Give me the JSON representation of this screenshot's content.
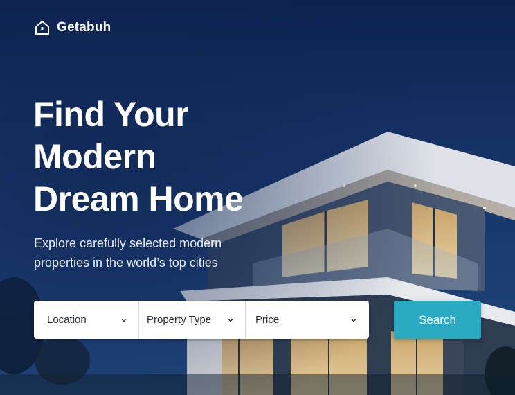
{
  "brand": {
    "name": "Getabuh",
    "icon": "house-icon"
  },
  "hero": {
    "headline_lines": [
      "Find Your",
      "Modern",
      "Dream Home"
    ],
    "subtitle_lines": [
      "Explore carefully selected modern",
      "properties in the world’s top cities"
    ]
  },
  "search": {
    "filters": [
      {
        "label": "Location",
        "icon": "chevron-down-icon"
      },
      {
        "label": "Property Type",
        "icon": "chevron-down-icon"
      },
      {
        "label": "Price",
        "icon": "chevron-down-icon"
      }
    ],
    "button_label": "Search"
  },
  "colors": {
    "accent": "#2aa9c2",
    "sky": "#173769",
    "text": "#ffffff"
  }
}
